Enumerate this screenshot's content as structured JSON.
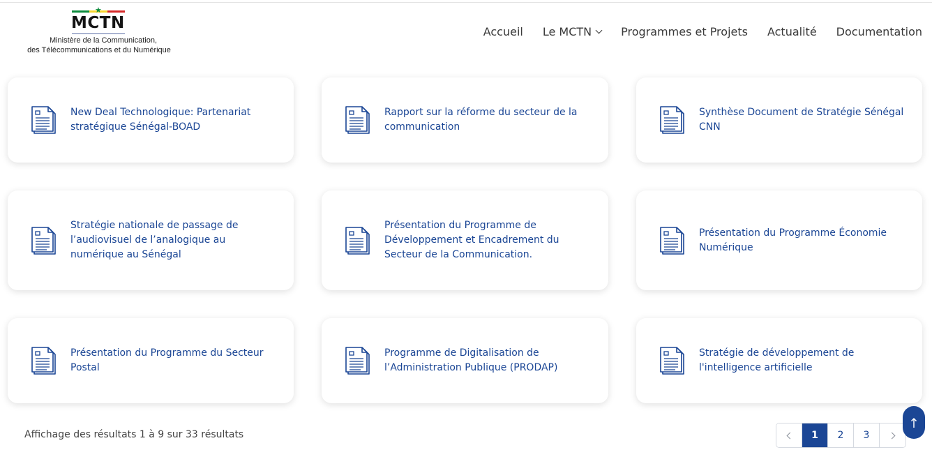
{
  "header": {
    "logo_title": "MCTN",
    "logo_subtitle_line1": "Ministère de la Communication,",
    "logo_subtitle_line2": "des Télécommunications et du Numérique",
    "flag_colors": [
      "#0b8b3c",
      "#f6d52f",
      "#d62828"
    ]
  },
  "nav": {
    "items": [
      {
        "label": "Accueil"
      },
      {
        "label": "Le MCTN",
        "has_dropdown": true
      },
      {
        "label": "Programmes et Projets"
      },
      {
        "label": "Actualité"
      },
      {
        "label": "Documentation"
      }
    ]
  },
  "documents": [
    {
      "title": "New Deal Technologique: Partenariat stratégique Sénégal-BOAD",
      "icon": "document-icon"
    },
    {
      "title": "Rapport sur la réforme du secteur de la communication",
      "icon": "document-icon"
    },
    {
      "title": "Synthèse Document de Stratégie Sénégal CNN",
      "icon": "document-icon"
    },
    {
      "title": "Stratégie nationale de passage de l’audiovisuel de l’analogique au numérique au Sénégal",
      "icon": "document-icon"
    },
    {
      "title": "Présentation du Programme de Développement et Encadrement du Secteur de la Communication.",
      "icon": "document-icon"
    },
    {
      "title": "Présentation du Programme Économie Numérique",
      "icon": "document-icon"
    },
    {
      "title": "Présentation du Programme du Secteur Postal",
      "icon": "document-icon"
    },
    {
      "title": "Programme de Digitalisation de l’Administration Publique (PRODAP)",
      "icon": "document-icon"
    },
    {
      "title": "Stratégie de développement de l'intelligence artificielle",
      "icon": "document-icon"
    }
  ],
  "footer": {
    "results_text": "Affichage des résultats 1 à 9 sur 33 résultats",
    "pagination": {
      "pages": [
        "1",
        "2",
        "3"
      ],
      "current": "1"
    }
  },
  "colors": {
    "accent": "#1b4695",
    "link_text": "#1b4695"
  }
}
